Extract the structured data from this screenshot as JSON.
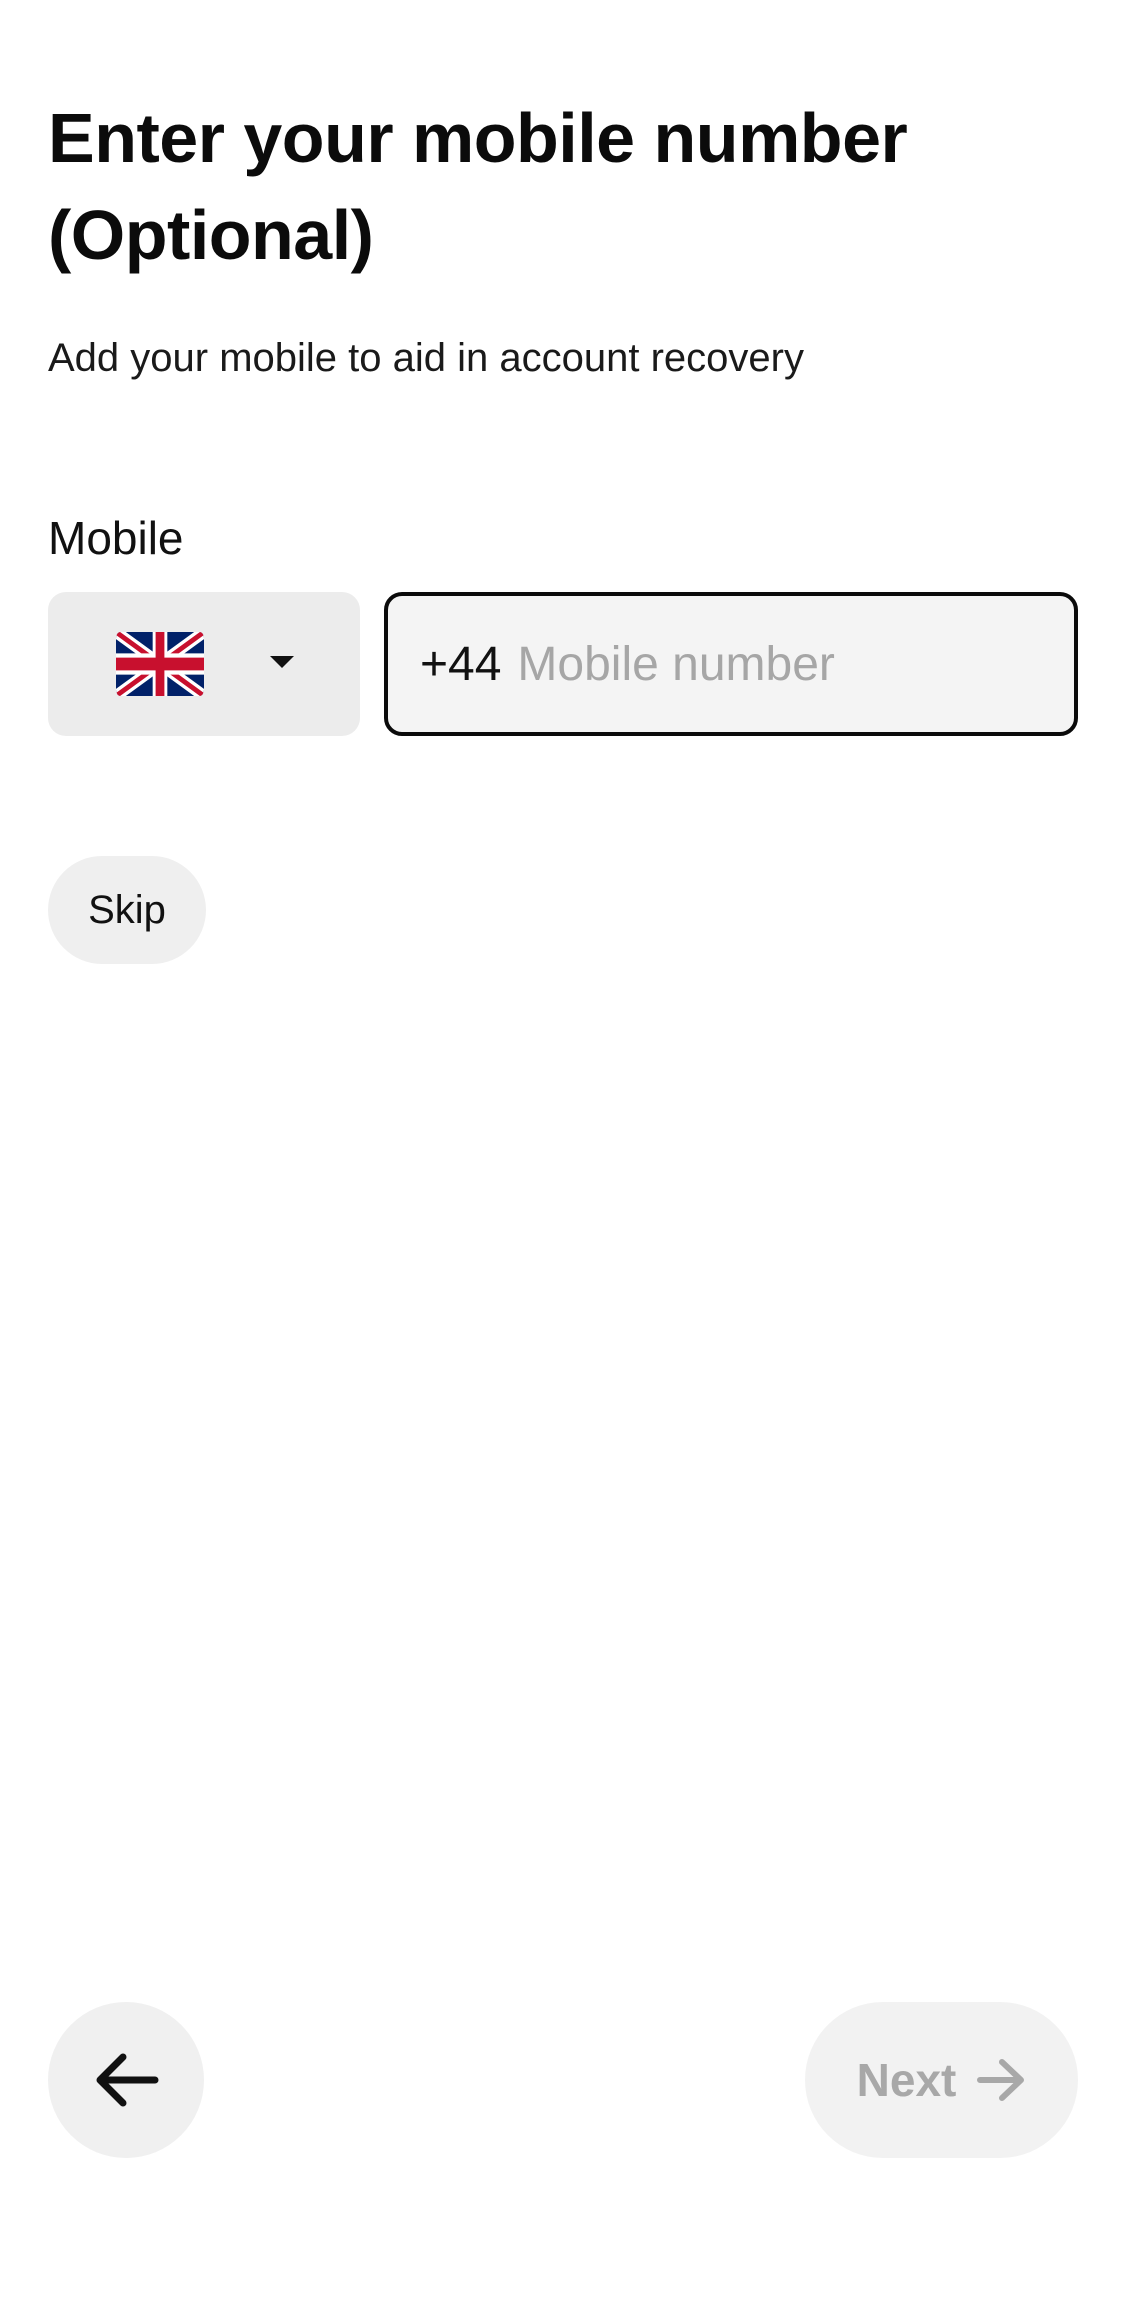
{
  "header": {
    "title": "Enter your mobile number (Optional)",
    "subtitle": "Add your mobile to aid in account recovery"
  },
  "form": {
    "mobile_label": "Mobile",
    "country": {
      "selected_flag_icon": "uk-flag-icon",
      "dropdown_icon": "caret-down-icon"
    },
    "phone": {
      "dial_code": "+44",
      "placeholder": "Mobile number",
      "value": ""
    }
  },
  "actions": {
    "skip_label": "Skip",
    "back_icon": "arrow-left-icon",
    "next_label": "Next",
    "next_icon": "arrow-right-icon",
    "next_enabled": false
  },
  "colors": {
    "text_primary": "#0b0b0b",
    "input_border": "#0b0b0b",
    "input_background": "#f4f4f4",
    "select_background": "#ececec",
    "button_background": "#efefef",
    "disabled_text": "#a8a8a8",
    "placeholder_text": "#a6a6a6"
  }
}
